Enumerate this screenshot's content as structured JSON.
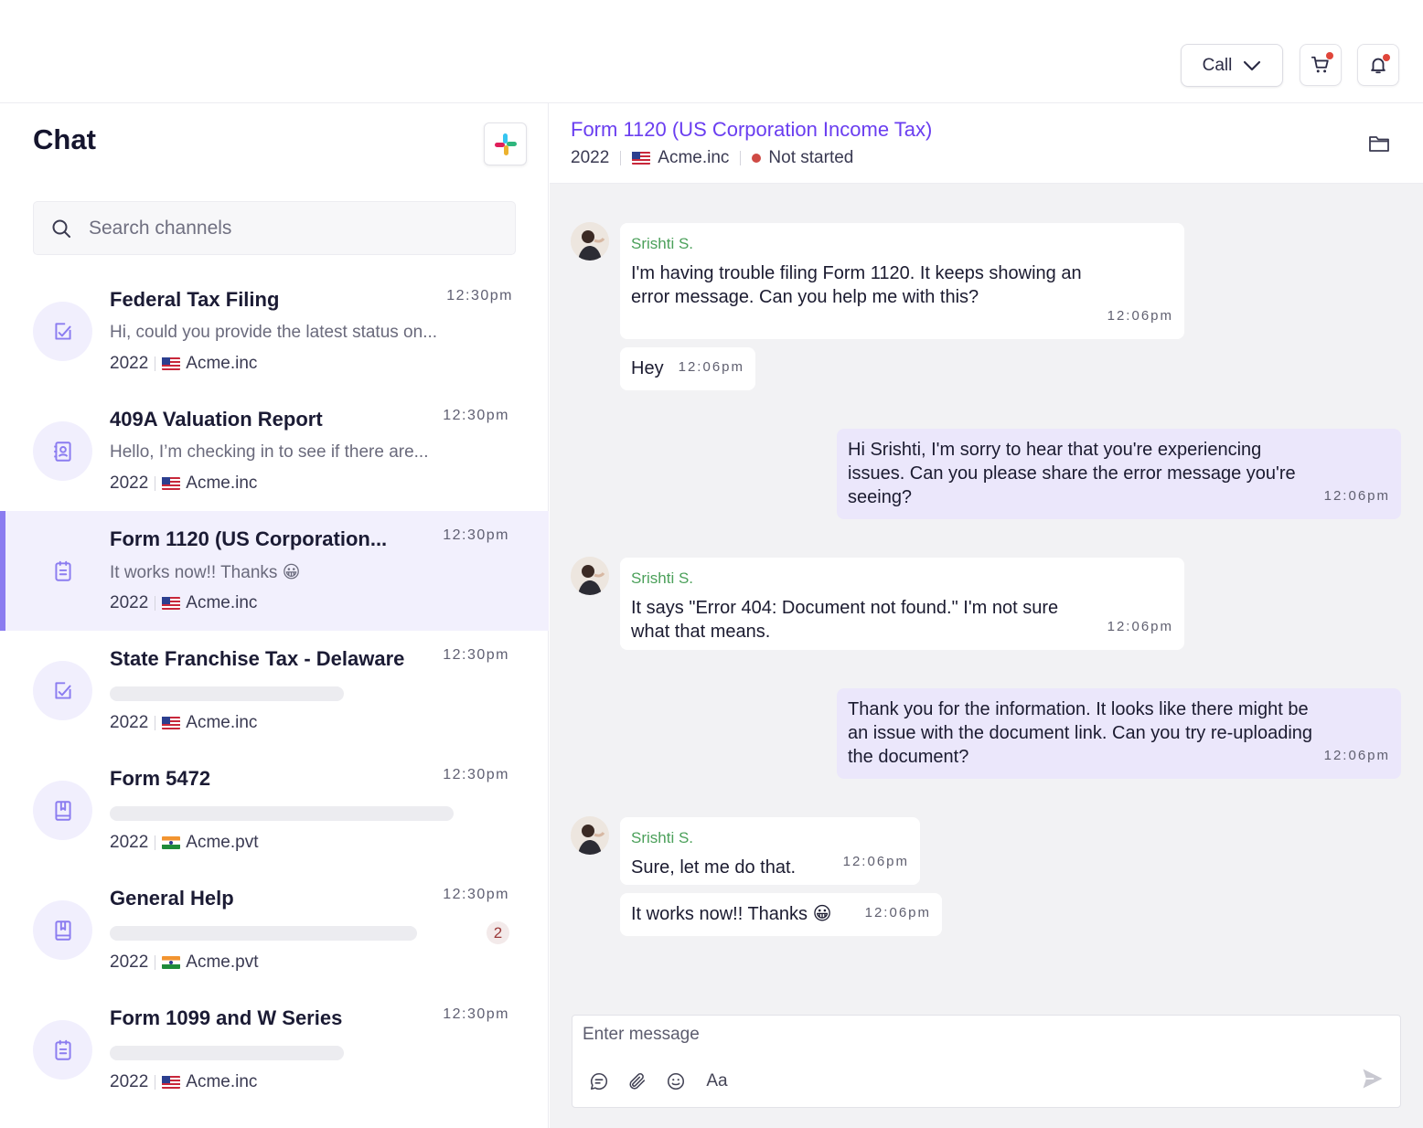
{
  "topbar": {
    "call_label": "Call",
    "icons": [
      "chevron-down-icon",
      "cart-icon",
      "bell-icon"
    ]
  },
  "sidebar": {
    "title": "Chat",
    "search_placeholder": "Search channels",
    "channels": [
      {
        "name": "Federal Tax Filing",
        "time": "12:30pm",
        "preview": "Hi, could you provide the latest status on...",
        "year": "2022",
        "company": "Acme.inc",
        "flag": "us",
        "icon": "task-check-icon"
      },
      {
        "name": "409A Valuation Report",
        "time": "12:30pm",
        "preview": "Hello, I’m checking in to see if there are...",
        "year": "2022",
        "company": "Acme.inc",
        "flag": "us",
        "icon": "contact-book-icon"
      },
      {
        "name": "Form 1120 (US Corporation...",
        "time": "12:30pm",
        "preview": "It works now!! Thanks 😀",
        "year": "2022",
        "company": "Acme.inc",
        "flag": "us",
        "icon": "notepad-icon",
        "active": true
      },
      {
        "name": "State Franchise Tax - Delaware",
        "time": "12:30pm",
        "preview": "",
        "year": "2022",
        "company": "Acme.inc",
        "flag": "us",
        "icon": "task-check-icon"
      },
      {
        "name": "Form 5472",
        "time": "12:30pm",
        "preview": "",
        "year": "2022",
        "company": "Acme.pvt",
        "flag": "in",
        "icon": "book-icon"
      },
      {
        "name": "General Help",
        "time": "12:30pm",
        "preview": "",
        "year": "2022",
        "company": "Acme.pvt",
        "flag": "in",
        "icon": "book-icon",
        "unread": "2"
      },
      {
        "name": "Form 1099 and W Series",
        "time": "12:30pm",
        "preview": "",
        "year": "2022",
        "company": "Acme.inc",
        "flag": "us",
        "icon": "notepad-icon"
      }
    ]
  },
  "conversation": {
    "title": "Form 1120 (US Corporation Income Tax)",
    "year": "2022",
    "company": "Acme.inc",
    "status": "Not started",
    "status_color": "#cf4a44",
    "accent_color": "#6a3ef0",
    "messages": [
      {
        "author": "Srishti S.",
        "text": "I'm having trouble filing Form 1120. It keeps showing an error message. Can you help me with this?",
        "time": "12:06pm",
        "direction": "in"
      },
      {
        "author": "",
        "text": "Hey",
        "time": "12:06pm",
        "direction": "in"
      },
      {
        "author": "",
        "text": "Hi Srishti, I'm sorry to hear that you're experiencing issues. Can you please share the error message you're seeing?",
        "time": "12:06pm",
        "direction": "out"
      },
      {
        "author": "Srishti S.",
        "text": "It says \"Error 404: Document not found.\" I'm not sure what that means.",
        "time": "12:06pm",
        "direction": "in"
      },
      {
        "author": "",
        "text": "Thank you for the information. It looks like there might be an issue with the document link. Can you try re-uploading the document?",
        "time": "12:06pm",
        "direction": "out"
      },
      {
        "author": "Srishti S.",
        "text": "Sure, let me do that.",
        "time": "12:06pm",
        "direction": "in"
      },
      {
        "author": "",
        "text": "It works now!! Thanks 😀",
        "time": "12:06pm",
        "direction": "in"
      }
    ],
    "composer": {
      "placeholder": "Enter message",
      "format_label": "Aa"
    }
  }
}
